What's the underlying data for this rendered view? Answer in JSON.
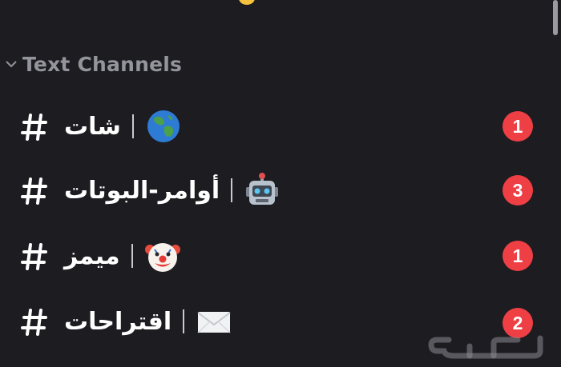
{
  "section": {
    "title": "Text Channels"
  },
  "channels": [
    {
      "name": "شات",
      "icon": "globe-emoji",
      "unread": "1"
    },
    {
      "name": "أوامر-البوتات",
      "icon": "robot-emoji",
      "unread": "3"
    },
    {
      "name": "ميمز",
      "icon": "clown-emoji",
      "unread": "1"
    },
    {
      "name": "اقتراحات",
      "icon": "envelope-emoji",
      "unread": "2"
    }
  ],
  "watermark": {
    "text": "حراج"
  },
  "colors": {
    "background": "#1c1c21",
    "category_text": "#94949c",
    "badge": "#ee3f45",
    "channel_text": "#ffffff"
  }
}
